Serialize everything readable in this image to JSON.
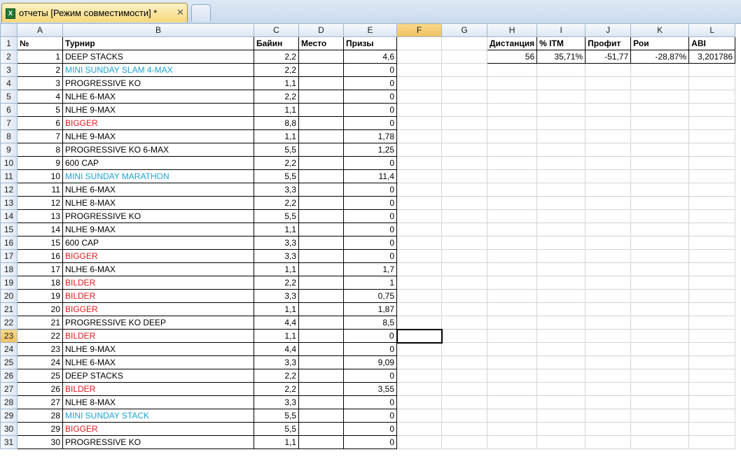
{
  "window": {
    "tab_title": "отчеты  [Режим совместимости] *",
    "close_glyph": "✕",
    "icon": "excel-icon"
  },
  "columns": [
    "A",
    "B",
    "C",
    "D",
    "E",
    "F",
    "G",
    "H",
    "I",
    "J",
    "K",
    "L"
  ],
  "selected_column": "F",
  "selected_row": 23,
  "headers": {
    "num": "№",
    "tournament": "Турнир",
    "buyin": "Байин",
    "place": "Место",
    "prizes": "Призы"
  },
  "stats": {
    "labels": [
      "Дистанция",
      "% ITM",
      "Профит",
      "Рои",
      "ABI"
    ],
    "values": [
      "56",
      "35,71%",
      "-51,77",
      "-28,87%",
      "3,201786"
    ]
  },
  "rows": [
    {
      "n": "1",
      "name": "DEEP STACKS",
      "buyin": "2,2",
      "prize": "4,6",
      "color": "black"
    },
    {
      "n": "2",
      "name": "MINI SUNDAY SLAM 4-MAX",
      "buyin": "2,2",
      "prize": "0",
      "color": "blue"
    },
    {
      "n": "3",
      "name": "PROGRESSIVE KO",
      "buyin": "1,1",
      "prize": "0",
      "color": "black"
    },
    {
      "n": "4",
      "name": "NLHE 6-MAX",
      "buyin": "2,2",
      "prize": "0",
      "color": "black"
    },
    {
      "n": "5",
      "name": "NLHE 9-MAX",
      "buyin": "1,1",
      "prize": "0",
      "color": "black"
    },
    {
      "n": "6",
      "name": "BIGGER",
      "buyin": "8,8",
      "prize": "0",
      "color": "red"
    },
    {
      "n": "7",
      "name": "NLHE 9-MAX",
      "buyin": "1,1",
      "prize": "1,78",
      "color": "black"
    },
    {
      "n": "8",
      "name": "PROGRESSIVE KO 6-MAX",
      "buyin": "5,5",
      "prize": "1,25",
      "color": "black"
    },
    {
      "n": "9",
      "name": "600 CAP",
      "buyin": "2,2",
      "prize": "0",
      "color": "black"
    },
    {
      "n": "10",
      "name": "MINI SUNDAY MARATHON",
      "buyin": "5,5",
      "prize": "11,4",
      "color": "blue"
    },
    {
      "n": "11",
      "name": "NLHE 6-MAX",
      "buyin": "3,3",
      "prize": "0",
      "color": "black"
    },
    {
      "n": "12",
      "name": "NLHE 8-MAX",
      "buyin": "2,2",
      "prize": "0",
      "color": "black"
    },
    {
      "n": "13",
      "name": "PROGRESSIVE KO",
      "buyin": "5,5",
      "prize": "0",
      "color": "black"
    },
    {
      "n": "14",
      "name": "NLHE 9-MAX",
      "buyin": "1,1",
      "prize": "0",
      "color": "black"
    },
    {
      "n": "15",
      "name": "600 CAP",
      "buyin": "3,3",
      "prize": "0",
      "color": "black"
    },
    {
      "n": "16",
      "name": "BIGGER",
      "buyin": "3,3",
      "prize": "0",
      "color": "red"
    },
    {
      "n": "17",
      "name": "NLHE 6-MAX",
      "buyin": "1,1",
      "prize": "1,7",
      "color": "black"
    },
    {
      "n": "18",
      "name": "BILDER",
      "buyin": "2,2",
      "prize": "1",
      "color": "red"
    },
    {
      "n": "19",
      "name": "BILDER",
      "buyin": "3,3",
      "prize": "0,75",
      "color": "red"
    },
    {
      "n": "20",
      "name": "BIGGER",
      "buyin": "1,1",
      "prize": "1,87",
      "color": "red"
    },
    {
      "n": "21",
      "name": "PROGRESSIVE KO DEEP",
      "buyin": "4,4",
      "prize": "8,5",
      "color": "black"
    },
    {
      "n": "22",
      "name": "BILDER",
      "buyin": "1,1",
      "prize": "0",
      "color": "red"
    },
    {
      "n": "23",
      "name": "NLHE 9-MAX",
      "buyin": "4,4",
      "prize": "0",
      "color": "black"
    },
    {
      "n": "24",
      "name": "NLHE 6-MAX",
      "buyin": "3,3",
      "prize": "9,09",
      "color": "black"
    },
    {
      "n": "25",
      "name": "DEEP STACKS",
      "buyin": "2,2",
      "prize": "0",
      "color": "black"
    },
    {
      "n": "26",
      "name": "BILDER",
      "buyin": "2,2",
      "prize": "3,55",
      "color": "red"
    },
    {
      "n": "27",
      "name": "NLHE 8-MAX",
      "buyin": "3,3",
      "prize": "0",
      "color": "black"
    },
    {
      "n": "28",
      "name": "MINI SUNDAY STACK",
      "buyin": "5,5",
      "prize": "0",
      "color": "blue"
    },
    {
      "n": "29",
      "name": "BIGGER",
      "buyin": "5,5",
      "prize": "0",
      "color": "red"
    },
    {
      "n": "30",
      "name": "PROGRESSIVE KO",
      "buyin": "1,1",
      "prize": "0",
      "color": "black"
    }
  ]
}
